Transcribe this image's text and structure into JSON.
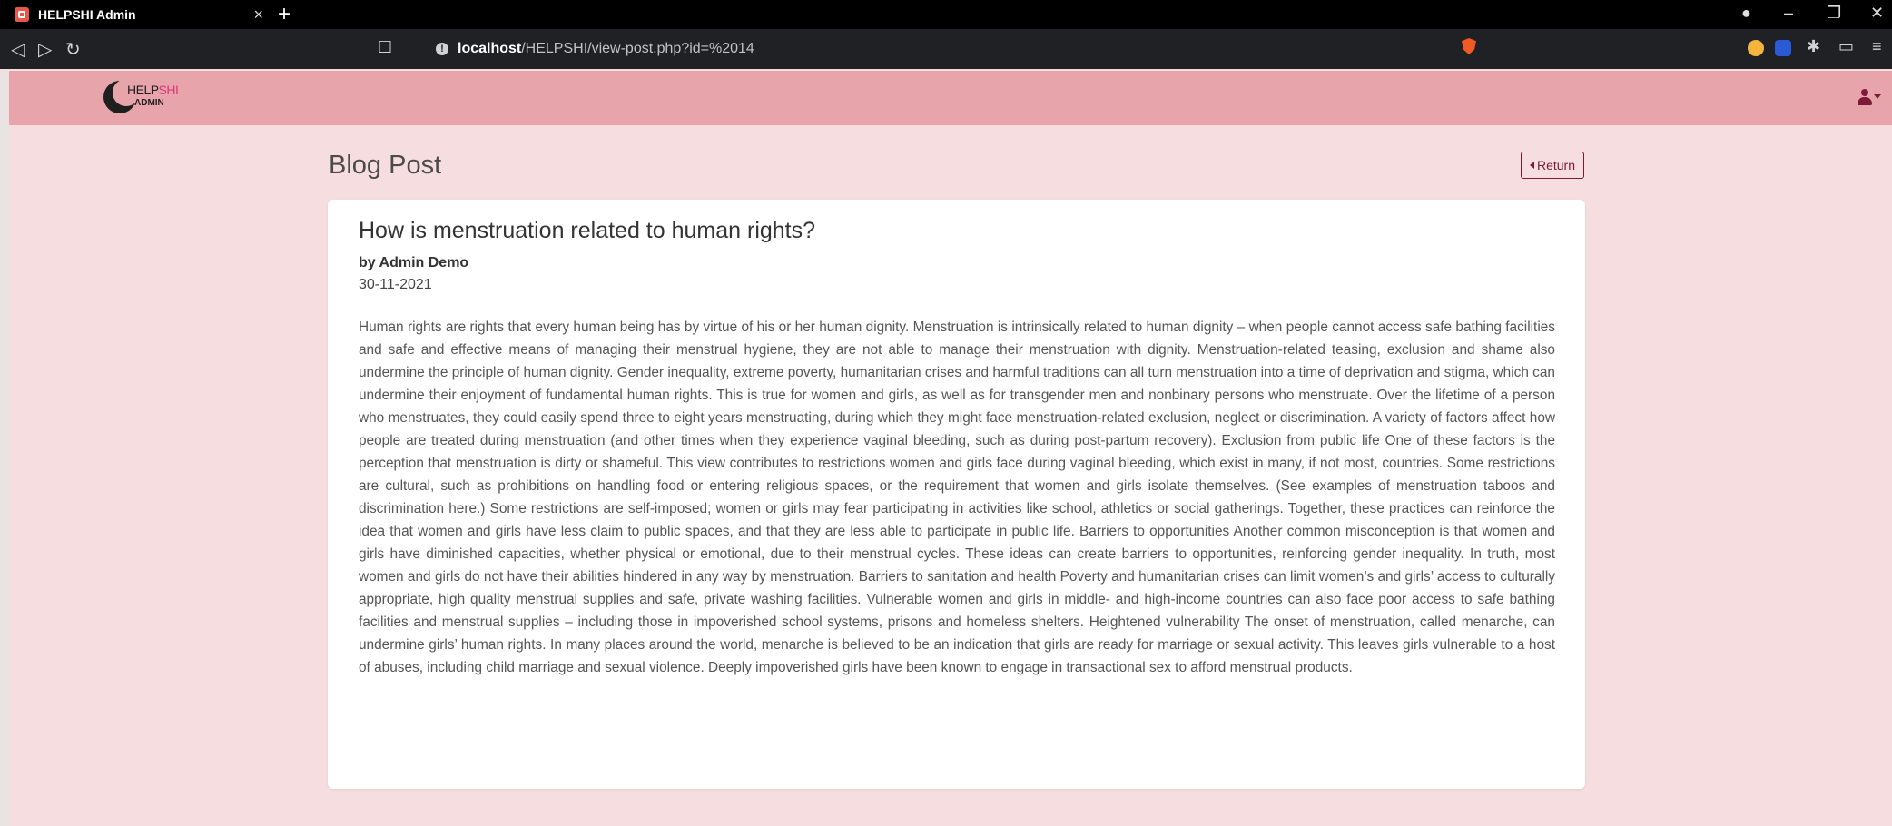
{
  "browser": {
    "tab_title": "HELPSHI Admin",
    "tab_close": "×",
    "new_tab": "+",
    "url_host": "localhost",
    "url_path": "/HELPSHI/view-post.php?id=%2014",
    "icons": [
      "back-icon",
      "forward-icon",
      "reload-icon",
      "bookmark-icon",
      "site-info-icon",
      "brave-shield-icon",
      "extensions-icon",
      "menu-icon"
    ]
  },
  "app": {
    "logo": {
      "help": "HELP",
      "shi": "SHI",
      "admin": "ADMIN"
    }
  },
  "page": {
    "title": "Blog Post",
    "return_label": "Return"
  },
  "post": {
    "title": "How is menstruation related to human rights?",
    "byline": "by Admin Demo",
    "date": "30-11-2021",
    "body": "Human rights are rights that every human being has by virtue of his or her human dignity. Menstruation is intrinsically related to human dignity – when people cannot access safe bathing facilities and safe and effective means of managing their menstrual hygiene, they are not able to manage their menstruation with dignity. Menstruation-related teasing, exclusion and shame also undermine the principle of human dignity. Gender inequality, extreme poverty, humanitarian crises and harmful traditions can all turn menstruation into a time of deprivation and stigma, which can undermine their enjoyment of fundamental human rights. This is true for women and girls, as well as for transgender men and nonbinary persons who menstruate. Over the lifetime of a person who menstruates, they could easily spend three to eight years menstruating, during which they might face menstruation-related exclusion, neglect or discrimination. A variety of factors affect how people are treated during menstruation (and other times when they experience vaginal bleeding, such as during post-partum recovery). Exclusion from public life One of these factors is the perception that menstruation is dirty or shameful. This view contributes to restrictions women and girls face during vaginal bleeding, which exist in many, if not most, countries. Some restrictions are cultural, such as prohibitions on handling food or entering religious spaces, or the requirement that women and girls isolate themselves. (See examples of menstruation taboos and discrimination here.) Some restrictions are self-imposed; women or girls may fear participating in activities like school, athletics or social gatherings. Together, these practices can reinforce the idea that women and girls have less claim to public spaces, and that they are less able to participate in public life. Barriers to opportunities Another common misconception is that women and girls have diminished capacities, whether physical or emotional, due to their menstrual cycles. These ideas can create barriers to opportunities, reinforcing gender inequality. In truth, most women and girls do not have their abilities hindered in any way by menstruation. Barriers to sanitation and health Poverty and humanitarian crises can limit women’s and girls’ access to culturally appropriate, high quality menstrual supplies and safe, private washing facilities. Vulnerable women and girls in middle- and high-income countries can also face poor access to safe bathing facilities and menstrual supplies – including those in impoverished school systems, prisons and homeless shelters. Heightened vulnerability The onset of menstruation, called menarche, can undermine girls’ human rights. In many places around the world, menarche is believed to be an indication that girls are ready for marriage or sexual activity. This leaves girls vulnerable to a host of abuses, including child marriage and sexual violence. Deeply impoverished girls have been known to engage in transactional sex to afford menstrual products."
  },
  "colors": {
    "navbar": "#e8a4ab",
    "page_bg": "#f6dde0",
    "accent": "#7d1a38"
  }
}
